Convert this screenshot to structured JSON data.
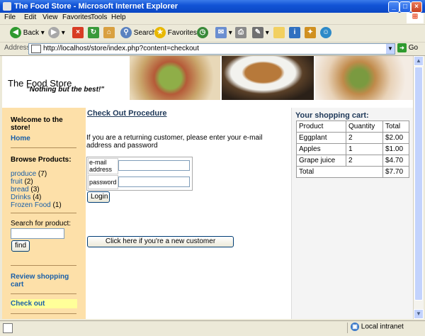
{
  "window": {
    "title": "The Food Store - Microsoft Internet Explorer"
  },
  "menu": [
    "File",
    "Edit",
    "View",
    "Favorites",
    "Tools",
    "Help"
  ],
  "toolbar": {
    "back": "Back",
    "search": "Search",
    "favorites": "Favorites"
  },
  "address": {
    "label": "Address",
    "url": "http://localhost/store/index.php?content=checkout",
    "go": "Go"
  },
  "status": {
    "zone": "Local intranet"
  },
  "banner": {
    "store_name": "The Food Store",
    "slogan": "\"Nothing but the best!\""
  },
  "sidebar": {
    "welcome": "Welcome to the store!",
    "home": "Home",
    "browse_heading": "Browse Products:",
    "categories": [
      {
        "name": "produce",
        "count": "(7)"
      },
      {
        "name": "fruit",
        "count": "(2)"
      },
      {
        "name": "bread",
        "count": "(3)"
      },
      {
        "name": "Drinks",
        "count": "(4)"
      },
      {
        "name": "Frozen Food",
        "count": "(1)"
      }
    ],
    "search_label": "Search for product:",
    "search_value": "",
    "find_button": "find",
    "review_cart": "Review shopping cart",
    "checkout": "Check out"
  },
  "main": {
    "title": "Check Out Procedure",
    "intro": "If you are a returning customer, please enter your e-mail address and password",
    "email_label": "e-mail address",
    "email_value": "",
    "password_label": "password",
    "password_value": "",
    "login_button": "Login",
    "new_customer_button": "Click here if you're a new customer"
  },
  "cart": {
    "title": "Your shopping cart:",
    "headers": [
      "Product",
      "Quantity",
      "Total"
    ],
    "rows": [
      [
        "Eggplant",
        "2",
        "$2.00"
      ],
      [
        "Apples",
        "1",
        "$1.00"
      ],
      [
        "Grape juice",
        "2",
        "$4.70"
      ]
    ],
    "total_label": "Total",
    "total_value": "$7.70"
  },
  "colors": {
    "sidebar_bg": "#fde0a9",
    "link": "#1a5fa8",
    "checkout_highlight": "#ffff99"
  },
  "icons": [
    "back-arrow-icon",
    "forward-arrow-icon",
    "stop-icon",
    "refresh-icon",
    "home-icon",
    "search-icon",
    "favorites-star-icon",
    "history-icon",
    "mail-icon",
    "print-icon",
    "edit-icon",
    "discuss-icon",
    "messenger-icon",
    "go-arrow-icon",
    "windows-logo-icon",
    "ie-page-icon",
    "intranet-icon"
  ]
}
